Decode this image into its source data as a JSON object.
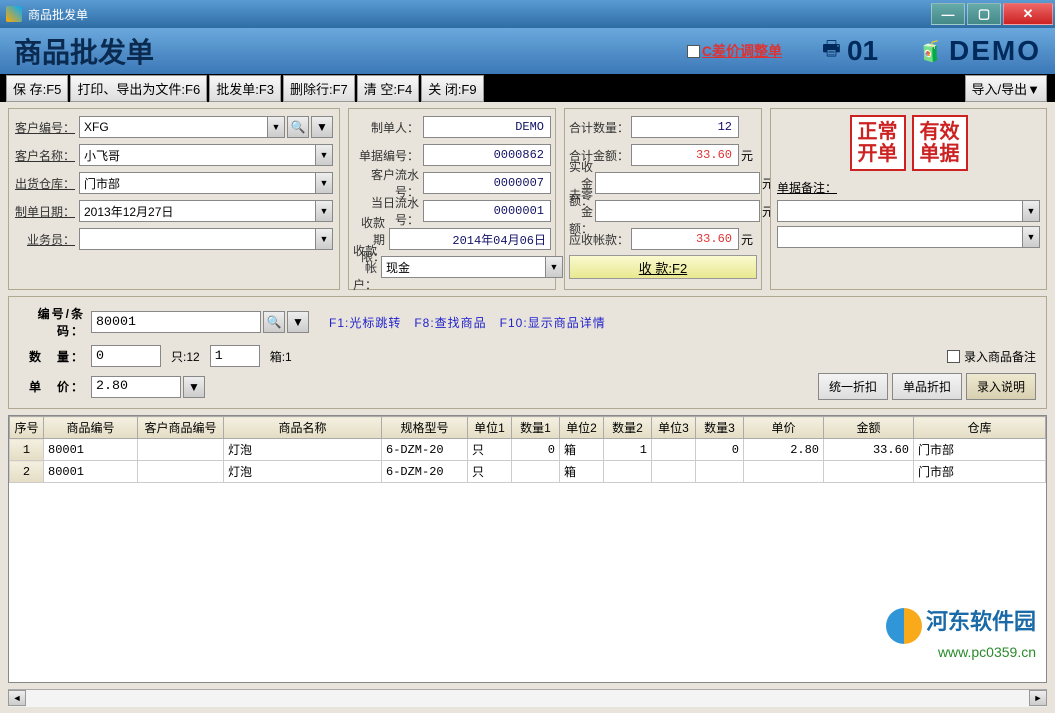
{
  "window": {
    "title": "商品批发单"
  },
  "header": {
    "title": "商品批发单",
    "adjust_label": "C差价调整单",
    "station": "01",
    "user": "DEMO"
  },
  "toolbar": {
    "save": "保 存:F5",
    "print": "打印、导出为文件:F6",
    "wholesale": "批发单:F3",
    "delrow": "删除行:F7",
    "clear": "清 空:F4",
    "close": "关 闭:F9",
    "import": "导入/导出▼"
  },
  "customer": {
    "code_label": "客户编号：",
    "code": "XFG",
    "name_label": "客户名称：",
    "name": "小飞哥",
    "warehouse_label": "出货仓库：",
    "warehouse": "门市部",
    "date_label": "制单日期：",
    "date": "2013年12月27日",
    "sales_label": "业务员：",
    "sales": ""
  },
  "bill": {
    "maker_label": "制单人：",
    "maker": "DEMO",
    "no_label": "单据编号：",
    "no": "0000862",
    "cflow_label": "客户流水号：",
    "cflow": "0000007",
    "dflow_label": "当日流水号：",
    "dflow": "0000001",
    "due_label": "收款期限：",
    "due": "2014年04月06日",
    "acct_label": "收款帐户：",
    "acct": "现金"
  },
  "totals": {
    "qty_label": "合计数量：",
    "qty": "12",
    "amt_label": "合计金额：",
    "amt": "33.60",
    "amt_unit": "元",
    "paid_label": "实收金额：",
    "paid": "",
    "paid_unit": "元",
    "round_label": "去零金额：",
    "round": "",
    "round_unit": "元",
    "recv_label": "应收帐款：",
    "recv": "33.60",
    "recv_unit": "元",
    "pay_btn": "收 款:F2"
  },
  "status": {
    "box1_l1": "正常",
    "box1_l2": "开单",
    "box2_l1": "有效",
    "box2_l2": "单据",
    "notes_label": "单据备注："
  },
  "entry": {
    "code_label": "编号/条码：",
    "code": "80001",
    "qty_label": "数　量：",
    "qty": "0",
    "qty_unit_lab": "只:12",
    "box_qty": "1",
    "box_unit_lab": "箱:1",
    "price_label": "单　价：",
    "price": "2.80",
    "hint": "F1:光标跳转　F8:查找商品　F10:显示商品详情",
    "chk_label": "录入商品备注",
    "btn_disc_all": "统一折扣",
    "btn_disc_one": "单品折扣",
    "btn_note": "录入说明"
  },
  "grid": {
    "headers": [
      "序号",
      "商品编号",
      "客户商品编号",
      "商品名称",
      "规格型号",
      "单位1",
      "数量1",
      "单位2",
      "数量2",
      "单位3",
      "数量3",
      "单价",
      "金额",
      "仓库"
    ],
    "rows": [
      {
        "rn": "1",
        "code": "80001",
        "ccode": "",
        "name": "灯泡",
        "spec": "6-DZM-20",
        "u1": "只",
        "q1": "0",
        "u2": "箱",
        "q2": "1",
        "u3": "",
        "q3": "0",
        "price": "2.80",
        "amount": "33.60",
        "wh": "门市部"
      },
      {
        "rn": "2",
        "code": "80001",
        "ccode": "",
        "name": "灯泡",
        "spec": "6-DZM-20",
        "u1": "只",
        "q1": "",
        "u2": "箱",
        "q2": "",
        "u3": "",
        "q3": "",
        "price": "",
        "amount": "",
        "wh": "门市部"
      }
    ]
  },
  "watermark": {
    "name": "河东软件园",
    "url": "www.pc0359.cn"
  }
}
